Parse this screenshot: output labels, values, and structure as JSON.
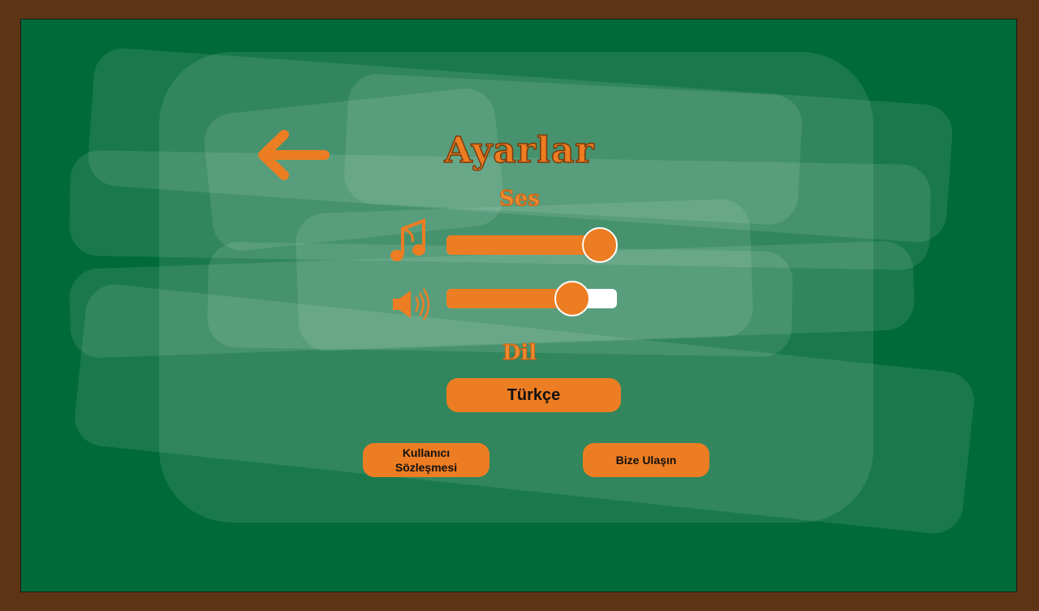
{
  "screen": {
    "title": "Ayarlar",
    "sound_section": "Ses",
    "language_section": "Dil"
  },
  "sliders": [
    {
      "name": "music",
      "icon": "music-note-icon",
      "value": 0.9
    },
    {
      "name": "sound-effects",
      "icon": "speaker-icon",
      "value": 0.74
    }
  ],
  "buttons": {
    "language": "Türkçe",
    "terms_line1": "Kullanıcı",
    "terms_line2": "Sözleşmesi",
    "contact": "Bize Ulaşın"
  },
  "icons": {
    "back": "back-arrow-icon"
  },
  "colors": {
    "accent": "#ed7d22",
    "board": "#006a38",
    "frame": "#5e3514",
    "track": "#ffffff"
  }
}
